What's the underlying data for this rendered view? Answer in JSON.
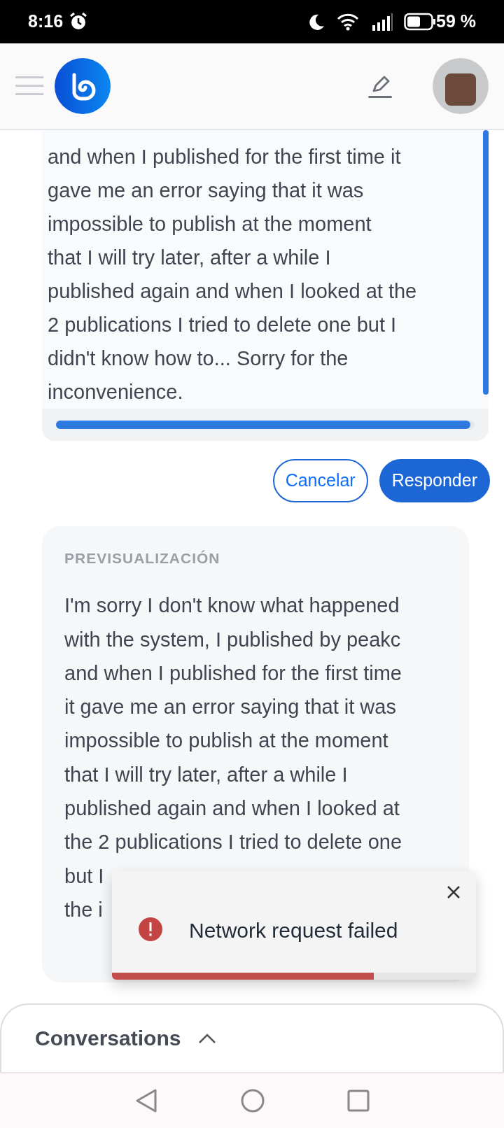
{
  "status_bar": {
    "time": "8:16",
    "battery": "59 %"
  },
  "editor": {
    "lines": [
      "and when I published for the first time it",
      "gave me an error saying that it was",
      "impossible to publish at the moment",
      "that I will try later, after a while I",
      "published again and when I looked at the",
      "2 publications I tried to delete one but I",
      "didn't know how to... Sorry for the",
      "inconvenience."
    ]
  },
  "actions": [
    {
      "label": "Cancelar",
      "kind": "outline"
    },
    {
      "label": "Responder",
      "kind": "primary"
    }
  ],
  "preview": {
    "label": "PREVISUALIZACIÓN",
    "lines": [
      "I'm sorry I don't know what happened",
      "with the system, I published by peakc",
      "and when I published for the first time",
      "it gave me an error saying that it was",
      "impossible to publish at the moment",
      "that I will try later, after a while I",
      "published again and when I looked at",
      "the 2 publications I tried to delete one",
      "but I",
      "the i"
    ]
  },
  "toast": {
    "message": "Network request failed",
    "level": 0.72
  },
  "conversations": {
    "title": "Conversations",
    "expanded": false
  }
}
